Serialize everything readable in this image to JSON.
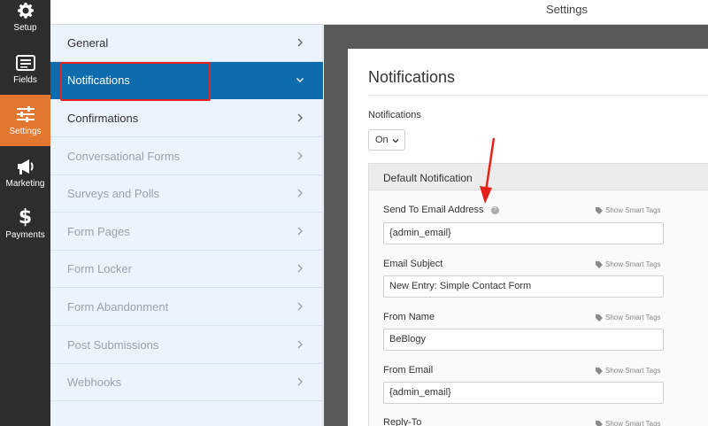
{
  "toolbar": {
    "items": [
      {
        "label": "Setup",
        "icon": "gear-icon"
      },
      {
        "label": "Fields",
        "icon": "fields-list-icon"
      },
      {
        "label": "Settings",
        "icon": "sliders-icon",
        "active": true
      },
      {
        "label": "Marketing",
        "icon": "megaphone-icon"
      },
      {
        "label": "Payments",
        "icon": "dollar-icon"
      }
    ]
  },
  "header": {
    "title": "Settings"
  },
  "panel": {
    "items": [
      {
        "label": "General",
        "state": "enabled"
      },
      {
        "label": "Notifications",
        "state": "selected"
      },
      {
        "label": "Confirmations",
        "state": "enabled"
      },
      {
        "label": "Conversational Forms",
        "state": "disabled"
      },
      {
        "label": "Surveys and Polls",
        "state": "disabled"
      },
      {
        "label": "Form Pages",
        "state": "disabled"
      },
      {
        "label": "Form Locker",
        "state": "disabled"
      },
      {
        "label": "Form Abandonment",
        "state": "disabled"
      },
      {
        "label": "Post Submissions",
        "state": "disabled"
      },
      {
        "label": "Webhooks",
        "state": "disabled"
      }
    ]
  },
  "main": {
    "title": "Notifications",
    "notifications_label": "Notifications",
    "notifications_value": "On",
    "default_notification": {
      "heading": "Default Notification",
      "smart_tags_label": "Show Smart Tags",
      "fields": [
        {
          "label": "Send To Email Address",
          "value": "{admin_email}"
        },
        {
          "label": "Email Subject",
          "value": "New Entry: Simple Contact Form"
        },
        {
          "label": "From Name",
          "value": "BeBlogy"
        },
        {
          "label": "From Email",
          "value": "{admin_email}"
        },
        {
          "label": "Reply-To",
          "value": ""
        }
      ]
    }
  },
  "colors": {
    "toolbar_bg": "#2d2d2d",
    "toolbar_active": "#e27730",
    "panel_bg": "#ebf3fc",
    "selected_bg": "#0e6cad",
    "annotation_red": "#e8201a"
  }
}
